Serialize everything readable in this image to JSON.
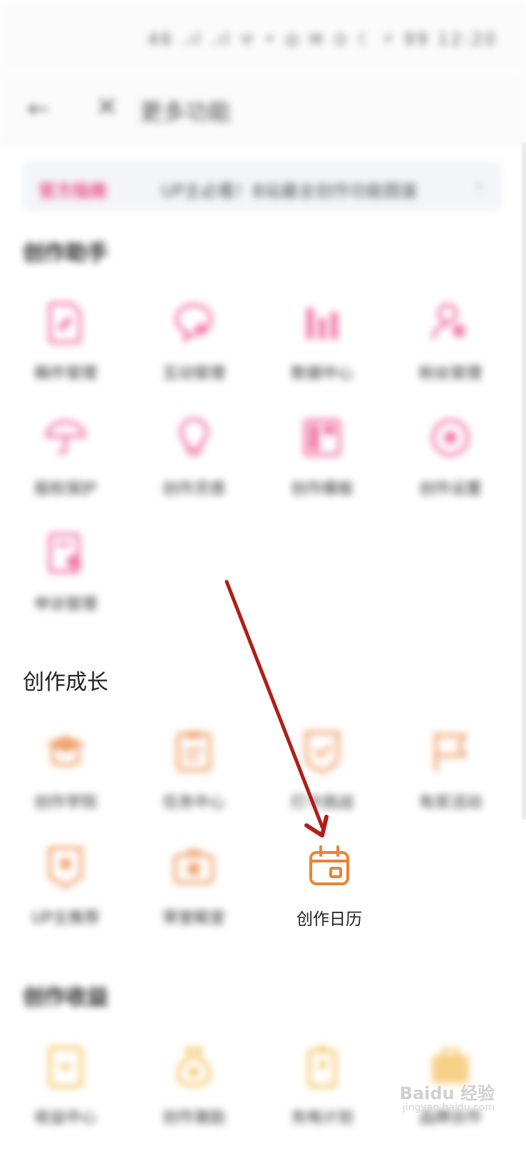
{
  "status_bar": {
    "text": "46 .ıl .ıl ᯤ • ◎ ✉ ⊙ ☾ ⚡ 99 12:20"
  },
  "nav": {
    "back_icon": "back-arrow-icon",
    "close_icon": "close-icon",
    "title": "更多功能"
  },
  "banner": {
    "tag": "官方指南",
    "text": "UP主必看！B站最全创作功能图鉴",
    "chevron": "›"
  },
  "sections": {
    "assistant": {
      "title": "创作助手",
      "items": [
        {
          "label": "稿件管理",
          "icon": "document-edit-icon"
        },
        {
          "label": "互动管理",
          "icon": "chat-bubble-icon"
        },
        {
          "label": "数据中心",
          "icon": "bar-chart-icon"
        },
        {
          "label": "粉丝管理",
          "icon": "user-icon"
        },
        {
          "label": "版权保护",
          "icon": "umbrella-icon"
        },
        {
          "label": "创作灵感",
          "icon": "lightbulb-icon"
        },
        {
          "label": "创作模板",
          "icon": "template-icon"
        },
        {
          "label": "创作设置",
          "icon": "settings-icon"
        },
        {
          "label": "申诉管理",
          "icon": "appeal-icon"
        }
      ]
    },
    "growth": {
      "title": "创作成长",
      "items": [
        {
          "label": "创作学院",
          "icon": "graduation-cap-icon"
        },
        {
          "label": "任务中心",
          "icon": "clipboard-icon"
        },
        {
          "label": "打卡挑战",
          "icon": "checkmark-shield-icon"
        },
        {
          "label": "有奖活动",
          "icon": "flag-icon"
        },
        {
          "label": "UP主推荐",
          "icon": "badge-icon"
        },
        {
          "label": "荣誉殿堂",
          "icon": "camera-icon"
        },
        {
          "label": "创作日历",
          "icon": "calendar-icon"
        }
      ]
    },
    "earnings": {
      "title": "创作收益",
      "items": [
        {
          "label": "收益中心",
          "icon": "card-icon"
        },
        {
          "label": "创作激励",
          "icon": "money-bag-icon"
        },
        {
          "label": "充电计划",
          "icon": "battery-icon"
        },
        {
          "label": "品牌合作",
          "icon": "briefcase-icon"
        }
      ]
    }
  },
  "watermark": {
    "text": "Baidu 经验",
    "sub": "jingyan.baidu.com"
  },
  "colors": {
    "pink": "#f27aa6",
    "orange": "#f0a26e",
    "orange_sharp": "#e8833a",
    "gold": "#f5c66b",
    "arrow": "#b01f18"
  }
}
